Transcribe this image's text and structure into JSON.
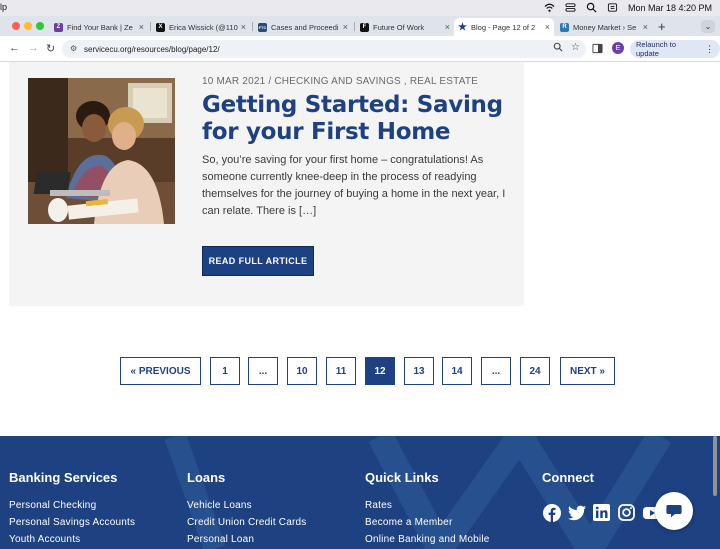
{
  "menubar": {
    "app_name": "lp",
    "datetime": "Mon Mar 18  4:20 PM"
  },
  "tabs": [
    {
      "label": "Find Your Bank | Ze",
      "favicon": "Z",
      "color": "#6b3fa0"
    },
    {
      "label": "Erica Wissick (@110",
      "favicon": "X",
      "color": "#111111"
    },
    {
      "label": "Cases and Proceedi",
      "favicon": "FTC",
      "color": "#2a4a7a"
    },
    {
      "label": "Future Of Work",
      "favicon": "F",
      "color": "#111111"
    },
    {
      "label": "Blog - Page 12 of 2",
      "favicon": "★",
      "color": "#1e4182"
    },
    {
      "label": "Money Market › Se",
      "favicon": "R",
      "color": "#2a7ab8"
    }
  ],
  "toolbar": {
    "url": "servicecu.org/resources/blog/page/12/",
    "relaunch_label": "Relaunch to update",
    "profile_initial": "E"
  },
  "article": {
    "date": "10 MAR 2021",
    "separator": "/",
    "categories": "CHECKING AND SAVINGS , REAL ESTATE",
    "title": "Getting Started: Saving for your First Home",
    "excerpt": "So, you’re saving for your first home – congratulations! As someone currently knee-deep in the process of readying themselves for the journey of buying a home in the next year, I can relate. There is […]",
    "button_label": "READ FULL ARTICLE"
  },
  "pagination": {
    "previous": "« PREVIOUS",
    "pages": [
      "1",
      "...",
      "10",
      "11",
      "12",
      "13",
      "14",
      "...",
      "24"
    ],
    "current": "12",
    "next": "NEXT »"
  },
  "footer": {
    "columns": [
      {
        "heading": "Banking Services",
        "links": [
          "Personal Checking",
          "Personal Savings Accounts",
          "Youth Accounts"
        ]
      },
      {
        "heading": "Loans",
        "links": [
          "Vehicle Loans",
          "Credit Union Credit Cards",
          "Personal Loan"
        ]
      },
      {
        "heading": "Quick Links",
        "links": [
          "Rates",
          "Become a Member",
          "Online Banking and Mobile"
        ]
      },
      {
        "heading": "Connect",
        "links": []
      }
    ],
    "social": [
      "facebook-icon",
      "twitter-icon",
      "linkedin-icon",
      "instagram-icon",
      "youtube-icon"
    ]
  },
  "colors": {
    "brand_blue": "#1e4182",
    "card_bg": "#f4f4f4"
  }
}
